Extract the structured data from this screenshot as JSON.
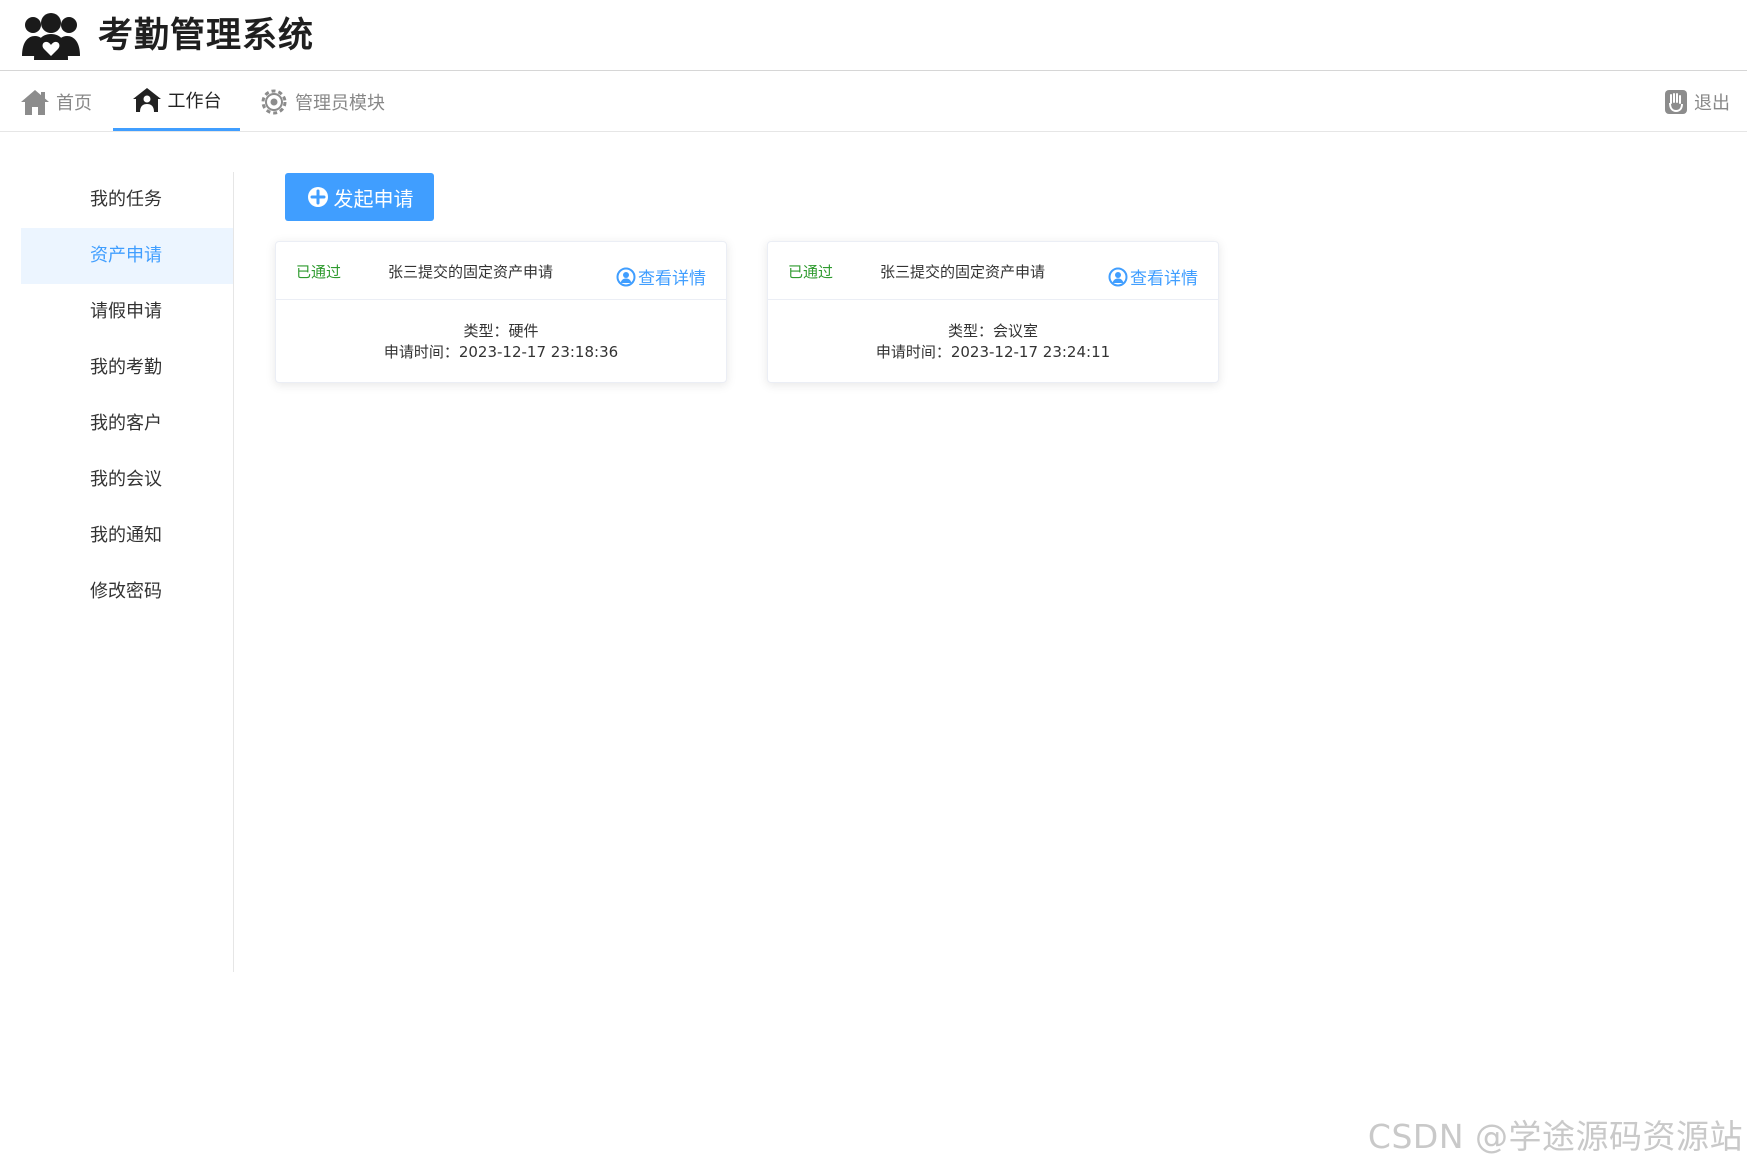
{
  "header": {
    "title": "考勤管理系统",
    "logo_icon": "people-heart-icon"
  },
  "topnav": {
    "items": [
      {
        "label": "首页",
        "icon": "home-icon"
      },
      {
        "label": "工作台",
        "icon": "workbench-icon",
        "active": true
      },
      {
        "label": "管理员模块",
        "icon": "gear-icon"
      }
    ],
    "logout": {
      "label": "退出",
      "icon": "logout-icon"
    },
    "accent": "#409eff"
  },
  "sidebar": {
    "items": [
      {
        "label": "我的任务"
      },
      {
        "label": "资产申请",
        "active": true
      },
      {
        "label": "请假申请"
      },
      {
        "label": "我的考勤"
      },
      {
        "label": "我的客户"
      },
      {
        "label": "我的会议"
      },
      {
        "label": "我的通知"
      },
      {
        "label": "修改密码"
      }
    ]
  },
  "main": {
    "apply_button": {
      "label": "发起申请",
      "icon": "plus-circle-icon"
    },
    "cards": [
      {
        "status": "已通过",
        "title": "张三提交的固定资产申请",
        "detail_label": "查看详情",
        "type_line": "类型：硬件",
        "time_line": "申请时间：2023-12-17 23:18:36"
      },
      {
        "status": "已通过",
        "title": "张三提交的固定资产申请",
        "detail_label": "查看详情",
        "type_line": "类型：会议室",
        "time_line": "申请时间：2023-12-17 23:24:11"
      }
    ],
    "status_color": "#2e9a2e"
  },
  "watermark": "CSDN @学途源码资源站"
}
